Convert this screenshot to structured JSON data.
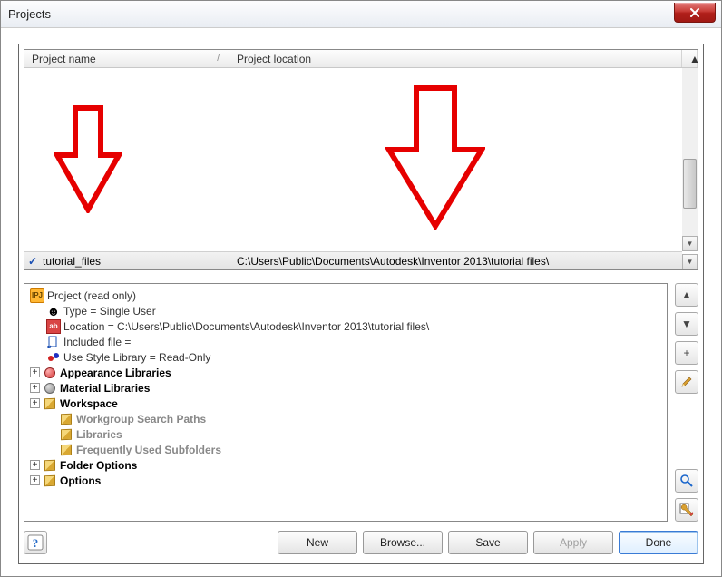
{
  "window": {
    "title": "Projects"
  },
  "columns": {
    "name": "Project name",
    "location": "Project location",
    "sortGlyph": "/"
  },
  "selectedProject": {
    "name": "tutorial_files",
    "location": "C:\\Users\\Public\\Documents\\Autodesk\\Inventor 2013\\tutorial files\\"
  },
  "tree": {
    "root": "Project (read only)",
    "type": "Type = Single User",
    "location": "Location = C:\\Users\\Public\\Documents\\Autodesk\\Inventor 2013\\tutorial files\\",
    "includedFile": "Included file =",
    "styleLib": "Use Style Library = Read-Only",
    "appearance": "Appearance Libraries",
    "material": "Material Libraries",
    "workspace": "Workspace",
    "workgroup": "Workgroup Search Paths",
    "libraries": "Libraries",
    "frequent": "Frequently Used Subfolders",
    "folderOptions": "Folder Options",
    "options": "Options"
  },
  "sideButtons": {
    "up": "▲",
    "down": "▼",
    "add": "+",
    "edit": "pencil",
    "find": "magnify",
    "config": "wrench"
  },
  "buttons": {
    "new": "New",
    "browse": "Browse...",
    "save": "Save",
    "apply": "Apply",
    "done": "Done"
  }
}
